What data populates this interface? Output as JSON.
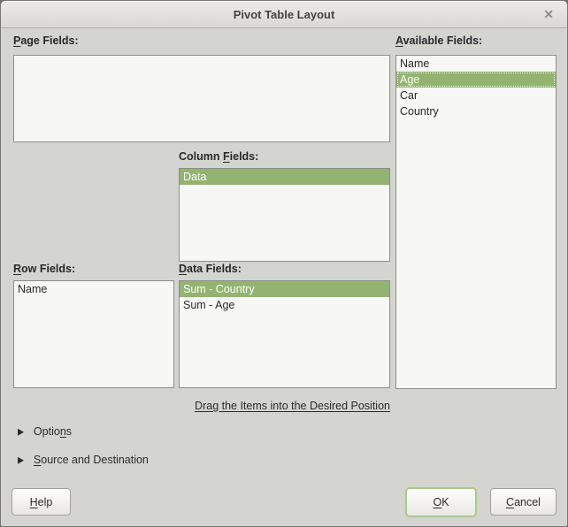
{
  "window": {
    "title": "Pivot Table Layout",
    "close_icon": "✕"
  },
  "labels": {
    "page_fields": {
      "pre": "",
      "key": "P",
      "post": "age Fields:"
    },
    "available_fields": {
      "pre": "",
      "key": "A",
      "post": "vailable Fields:"
    },
    "column_fields": {
      "pre": "Column ",
      "key": "F",
      "post": "ields:"
    },
    "row_fields": {
      "pre": "",
      "key": "R",
      "post": "ow Fields:"
    },
    "data_fields": {
      "pre": "",
      "key": "D",
      "post": "ata Fields:"
    },
    "drag_hint": "Drag the Items into the Desired Position"
  },
  "lists": {
    "page_fields": [],
    "available_fields": [
      {
        "label": "Name"
      },
      {
        "label": "Age",
        "selected": true,
        "focused": true
      },
      {
        "label": "Car"
      },
      {
        "label": "Country"
      }
    ],
    "column_fields": [
      {
        "label": "Data",
        "selected": true
      }
    ],
    "row_fields": [
      {
        "label": "Name"
      }
    ],
    "data_fields": [
      {
        "label": "Sum - Country",
        "selected": true
      },
      {
        "label": "Sum - Age"
      }
    ]
  },
  "expanders": {
    "icon": "▶",
    "options": {
      "pre": "Optio",
      "key": "n",
      "post": "s"
    },
    "source_destination": {
      "pre": "",
      "key": "S",
      "post": "ource and Destination"
    }
  },
  "buttons": {
    "help": {
      "pre": "",
      "key": "H",
      "post": "elp"
    },
    "ok": {
      "pre": "",
      "key": "O",
      "post": "K"
    },
    "cancel": {
      "pre": "",
      "key": "C",
      "post": "ancel"
    }
  },
  "colors": {
    "selection_green": "#93b471",
    "ok_ring": "#a8ca8c"
  }
}
